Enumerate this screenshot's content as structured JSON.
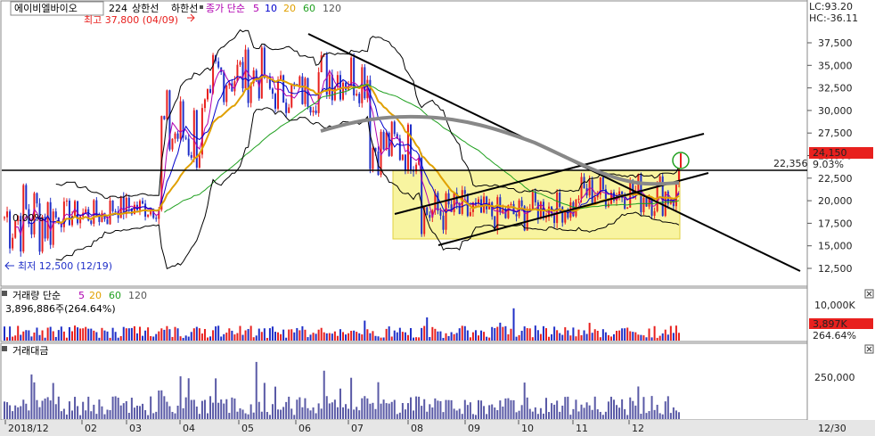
{
  "header": {
    "stock_name": "에이비엘바이오",
    "period": "224",
    "limit_up": "상한선",
    "limit_down": "하한선",
    "ma_label": "종가 단순",
    "ma_periods": [
      "5",
      "10",
      "20",
      "60",
      "120"
    ],
    "ma_colors": [
      "#b000b0",
      "#0000cc",
      "#e0a000",
      "#20a020",
      "#555555"
    ]
  },
  "price_panel": {
    "high_label": "최고 37,800 (04/09)",
    "low_label": "최저 12,500 (12/19)",
    "left_pct_label": "0.00%",
    "lc_label": "LC:93.20",
    "hc_label": "HC:-36.11",
    "horizontal_line_label": "22,356",
    "current_price": "24,150",
    "current_change": "9.03%",
    "y_ticks": [
      "37,500",
      "35,000",
      "32,500",
      "30,000",
      "27,500",
      "25,000",
      "22,500",
      "20,000",
      "17,500",
      "15,000",
      "12,500"
    ]
  },
  "volume_panel": {
    "title": "거래량 단순",
    "ma_periods": [
      "5",
      "20",
      "60",
      "120"
    ],
    "value_label": "3,896,886주(264.64%)",
    "current_value": "3,897K",
    "current_pct": "264.64%",
    "y_ticks": [
      "10,000K"
    ]
  },
  "amount_panel": {
    "title": "거래대금",
    "y_ticks": [
      "250,000"
    ]
  },
  "x_axis": {
    "labels": [
      "2018/12",
      "02",
      "03",
      "04",
      "05",
      "06",
      "07",
      "08",
      "09",
      "10",
      "11",
      "12"
    ],
    "end_label": "12/30"
  },
  "colors": {
    "up": "#e8201e",
    "down": "#2030c8",
    "box_fill": "#f8f4a0",
    "bollinger": "#000000",
    "volume_bar": "#5a5aa6",
    "current_bg": "#e8201e"
  },
  "chart_data": {
    "type": "candlestick",
    "price_range": [
      10500,
      40000
    ],
    "price_series_monthly_approx": [
      {
        "month": "2018/12",
        "low": 12500,
        "high": 24000
      },
      {
        "month": "01",
        "low": 16500,
        "high": 20500
      },
      {
        "month": "02",
        "low": 17500,
        "high": 21000
      },
      {
        "month": "03",
        "low": 21000,
        "high": 34000
      },
      {
        "month": "04",
        "low": 30000,
        "high": 37800
      },
      {
        "month": "05",
        "low": 29000,
        "high": 35000
      },
      {
        "month": "06",
        "low": 30000,
        "high": 38000
      },
      {
        "month": "07",
        "low": 22000,
        "high": 30000
      },
      {
        "month": "08",
        "low": 15500,
        "high": 22000
      },
      {
        "month": "09",
        "low": 16000,
        "high": 21000
      },
      {
        "month": "10",
        "low": 17000,
        "high": 21500
      },
      {
        "month": "11",
        "low": 18500,
        "high": 23500
      },
      {
        "month": "12",
        "low": 17500,
        "high": 24150
      }
    ]
  }
}
